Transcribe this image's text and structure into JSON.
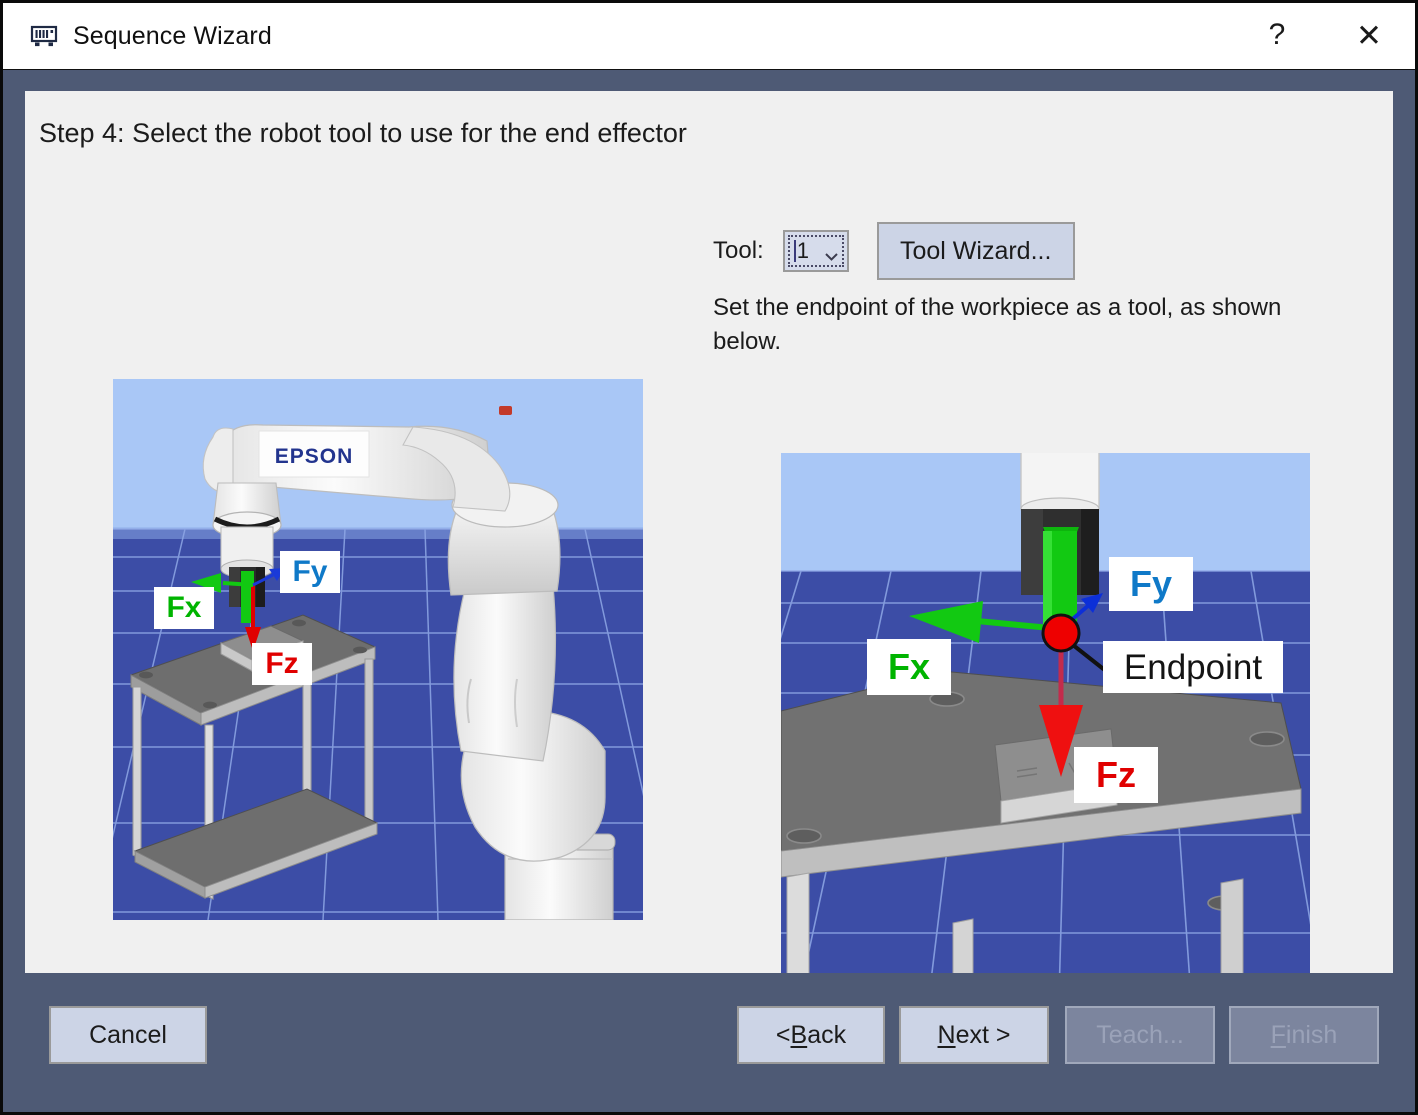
{
  "window": {
    "title": "Sequence Wizard",
    "icon": "memory-module-icon",
    "help_label": "?",
    "close_label": "✕"
  },
  "content": {
    "step_title": "Step 4: Select the robot tool to use for the end effector",
    "tool": {
      "label": "Tool:",
      "selected_value": "1",
      "options": [
        "1"
      ],
      "wizard_button": "Tool Wizard..."
    },
    "description": "Set the endpoint of the workpiece as a tool, as shown below.",
    "scenes": {
      "left": {
        "name": "robot-overview-scene",
        "brand": "EPSON",
        "labels": [
          {
            "text": "Fx",
            "color": "#00b400"
          },
          {
            "text": "Fy",
            "color": "#0f79c8"
          },
          {
            "text": "Fz",
            "color": "#e00000"
          }
        ]
      },
      "right": {
        "name": "endpoint-detail-scene",
        "labels": [
          {
            "text": "Fx",
            "color": "#00b400"
          },
          {
            "text": "Fy",
            "color": "#0f79c8"
          },
          {
            "text": "Fz",
            "color": "#e00000"
          },
          {
            "text": "Endpoint",
            "color": "#141414"
          }
        ]
      }
    }
  },
  "footer": {
    "cancel": "Cancel",
    "back_prefix": "< ",
    "back_accel": "B",
    "back_rest": "ack",
    "next_accel": "N",
    "next_rest": "ext >",
    "teach": "Teach...",
    "finish_accel": "F",
    "finish_rest": "inish"
  },
  "colors": {
    "frame": "#4e5a75",
    "panel": "#f0f0f0",
    "button": "#ccd4e6",
    "sky": "#a9c7f6",
    "floor": "#3a4ba0",
    "axis_x": "#00b400",
    "axis_y": "#0f79c8",
    "axis_z": "#e00000"
  }
}
